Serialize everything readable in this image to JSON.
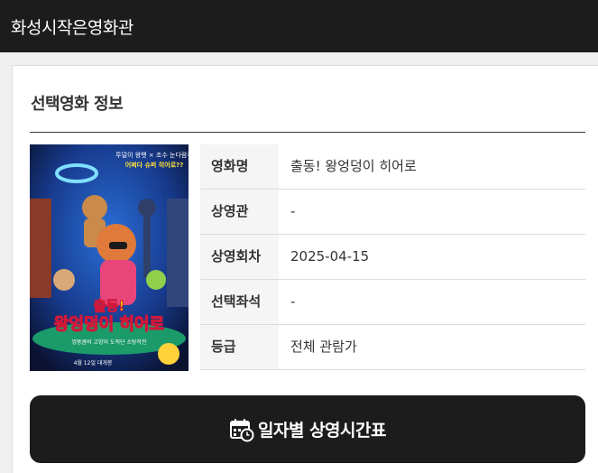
{
  "header": {
    "title": "화성시작은영화관"
  },
  "section": {
    "title": "선택영화 정보"
  },
  "poster": {
    "top_text_1": "투덜이 왕뱃 × 조수 눈다람쥐",
    "top_text_2": "어쩌다 슈퍼 히어로??",
    "title_line_1": "출동!",
    "title_line_2": "왕엉덩이 히어로",
    "tagline": "엉뚱콤비 고양이 도적단 소탕작전",
    "release": "4월 12일 대개봉"
  },
  "movie_info": [
    {
      "label": "영화명",
      "value": "출동! 왕엉덩이 히어로"
    },
    {
      "label": "상영관",
      "value": "-"
    },
    {
      "label": "상영회차",
      "value": "2025-04-15"
    },
    {
      "label": "선택좌석",
      "value": "-"
    },
    {
      "label": "등급",
      "value": "전체 관람가"
    }
  ],
  "schedule_button": {
    "label": "일자별 상영시간표",
    "icon": "calendar-clock-icon"
  }
}
